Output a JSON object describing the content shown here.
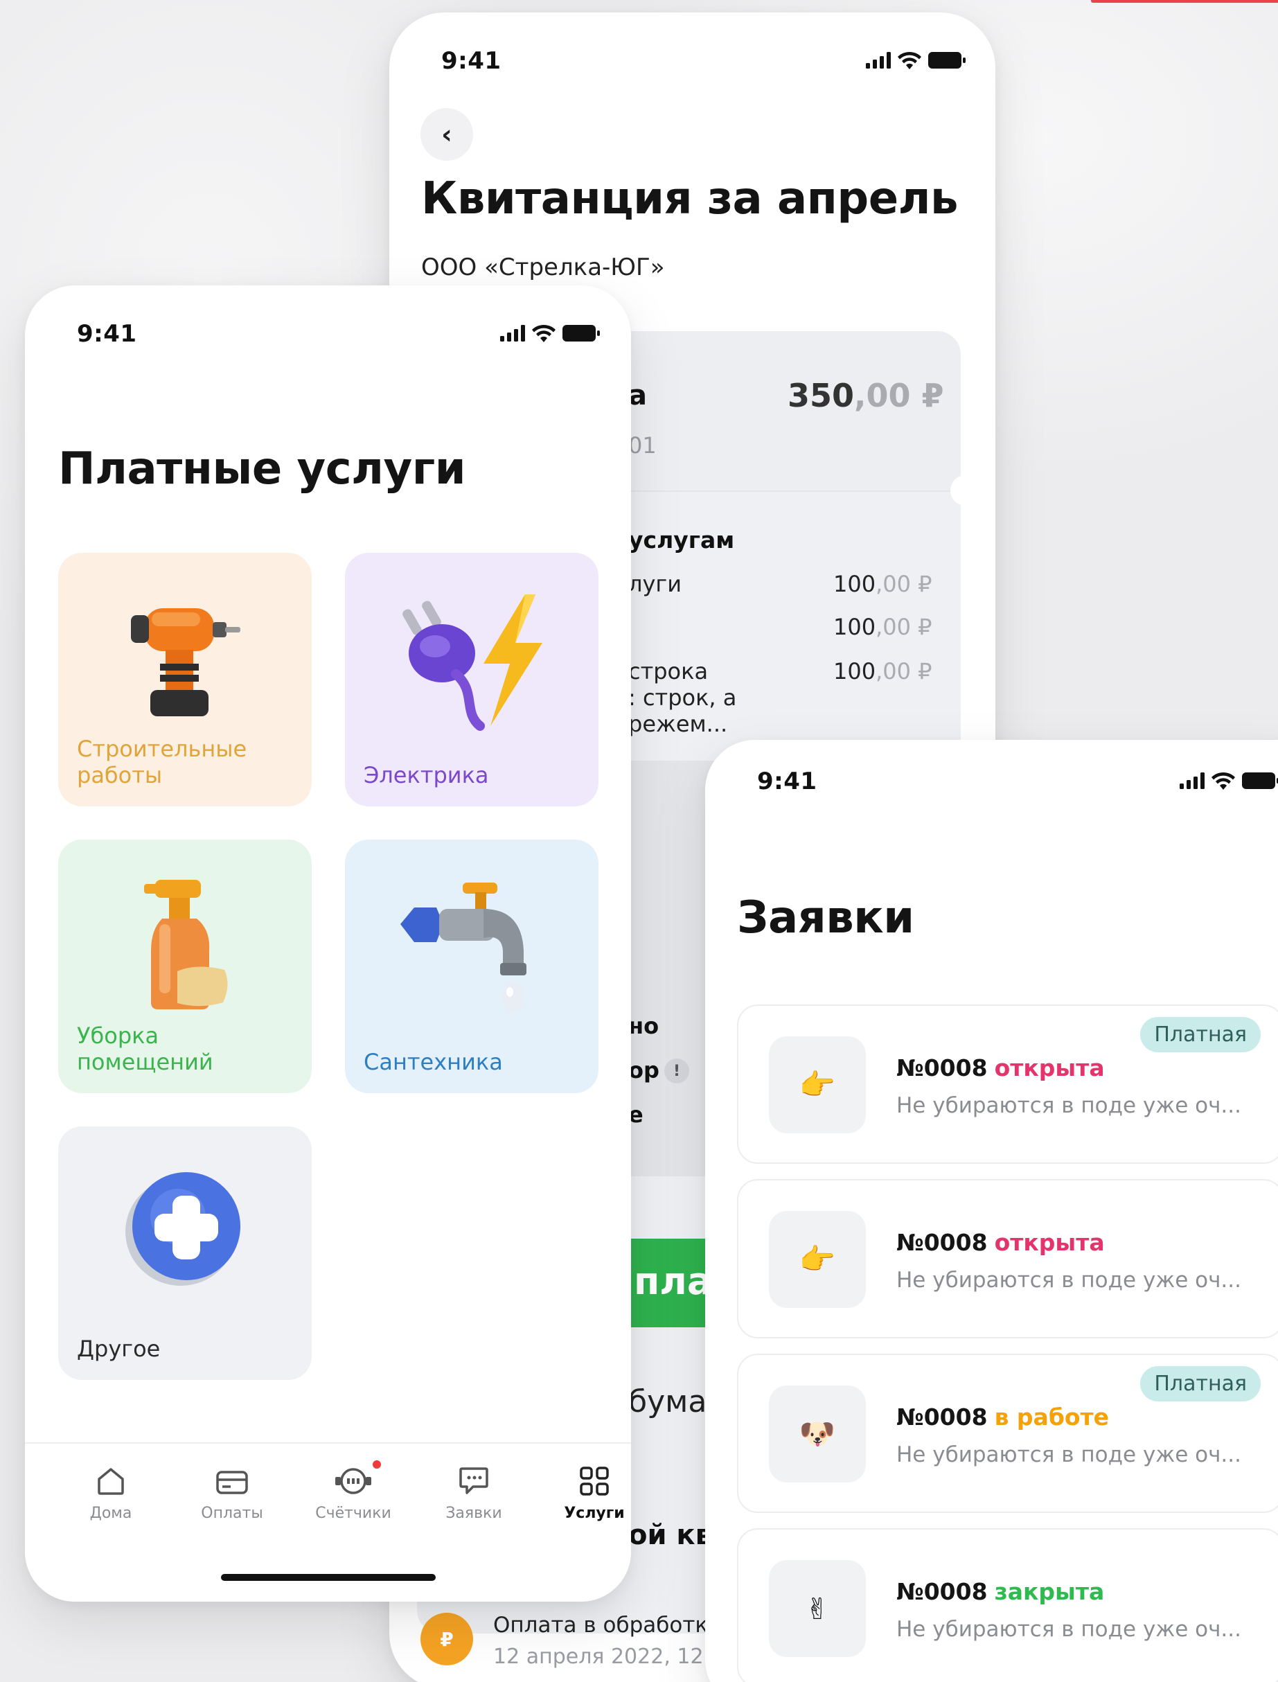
{
  "status_time": "9:41",
  "colors": {
    "accent_green": "#2fb24e",
    "status_open": "#e4346c",
    "status_work": "#f5a10a",
    "status_closed": "#2eba4f",
    "badge_bg": "#c9ecea"
  },
  "receipt": {
    "title": "Квитанция за апрель",
    "company": "ООО «Стрелка-ЮГ»",
    "name_part": "а",
    "sub_part": "01",
    "amount_main": "350",
    "amount_cents": ",00 ₽",
    "section_title": "услугам",
    "lines": [
      {
        "text": "луги",
        "price_main": "100",
        "price_cents": ",00 ₽"
      },
      {
        "text": "",
        "price_main": "100",
        "price_cents": ",00 ₽"
      },
      {
        "text": "строка\n: строк, а\nрежем...",
        "price_main": "100",
        "price_cents": ",00 ₽"
      }
    ],
    "bold_lines": [
      "но",
      "ор",
      "е"
    ],
    "pay_button": "плат",
    "paper_text": "бумах",
    "history_title": "ой кв",
    "history_icon": "₽",
    "history_text": "Оплата в обработке",
    "history_date": "12 апреля 2022, 12:"
  },
  "services": {
    "title": "Платные услуги",
    "tiles": [
      {
        "label": "Строительные\nработы",
        "bg": "#fdf0e2",
        "color": "#e0a53a",
        "icon": "drill-icon"
      },
      {
        "label": "Электрика",
        "bg": "#f0e9fb",
        "color": "#7a48c9",
        "icon": "plug-lightning-icon"
      },
      {
        "label": "Уборка\nпомещений",
        "bg": "#e6f6ea",
        "color": "#3cb44e",
        "icon": "spray-bottle-icon"
      },
      {
        "label": "Сантехника",
        "bg": "#e4f1fb",
        "color": "#2c7fc2",
        "icon": "faucet-icon"
      },
      {
        "label": "Другое",
        "bg": "#f0f1f4",
        "color": "#2a2a2a",
        "icon": "plus-icon"
      }
    ],
    "tabs": [
      {
        "label": "Дома",
        "icon": "home-icon",
        "active": false
      },
      {
        "label": "Оплаты",
        "icon": "card-icon",
        "active": false
      },
      {
        "label": "Счётчики",
        "icon": "meter-icon",
        "active": false
      },
      {
        "label": "Заявки",
        "icon": "chat-icon",
        "active": false
      },
      {
        "label": "Услуги",
        "icon": "grid-icon",
        "active": true
      }
    ]
  },
  "requests": {
    "title": "Заявки",
    "items": [
      {
        "number": "№0008",
        "status": "открыта",
        "status_kind": "open",
        "desc": "Не убираются в поде уже оч...",
        "badge": "Платная",
        "dot": true,
        "emoji": "👉"
      },
      {
        "number": "№0008",
        "status": "открыта",
        "status_kind": "open",
        "desc": "Не убираются в поде уже оч...",
        "badge": "",
        "dot": true,
        "emoji": "👉"
      },
      {
        "number": "№0008",
        "status": "в работе",
        "status_kind": "work",
        "desc": "Не убираются в поде уже оч...",
        "badge": "Платная",
        "dot": false,
        "emoji": "🐶"
      },
      {
        "number": "№0008",
        "status": "закрыта",
        "status_kind": "closed",
        "desc": "Не убираются в поде уже оч...",
        "badge": "",
        "dot": false,
        "emoji": "✌"
      }
    ]
  }
}
